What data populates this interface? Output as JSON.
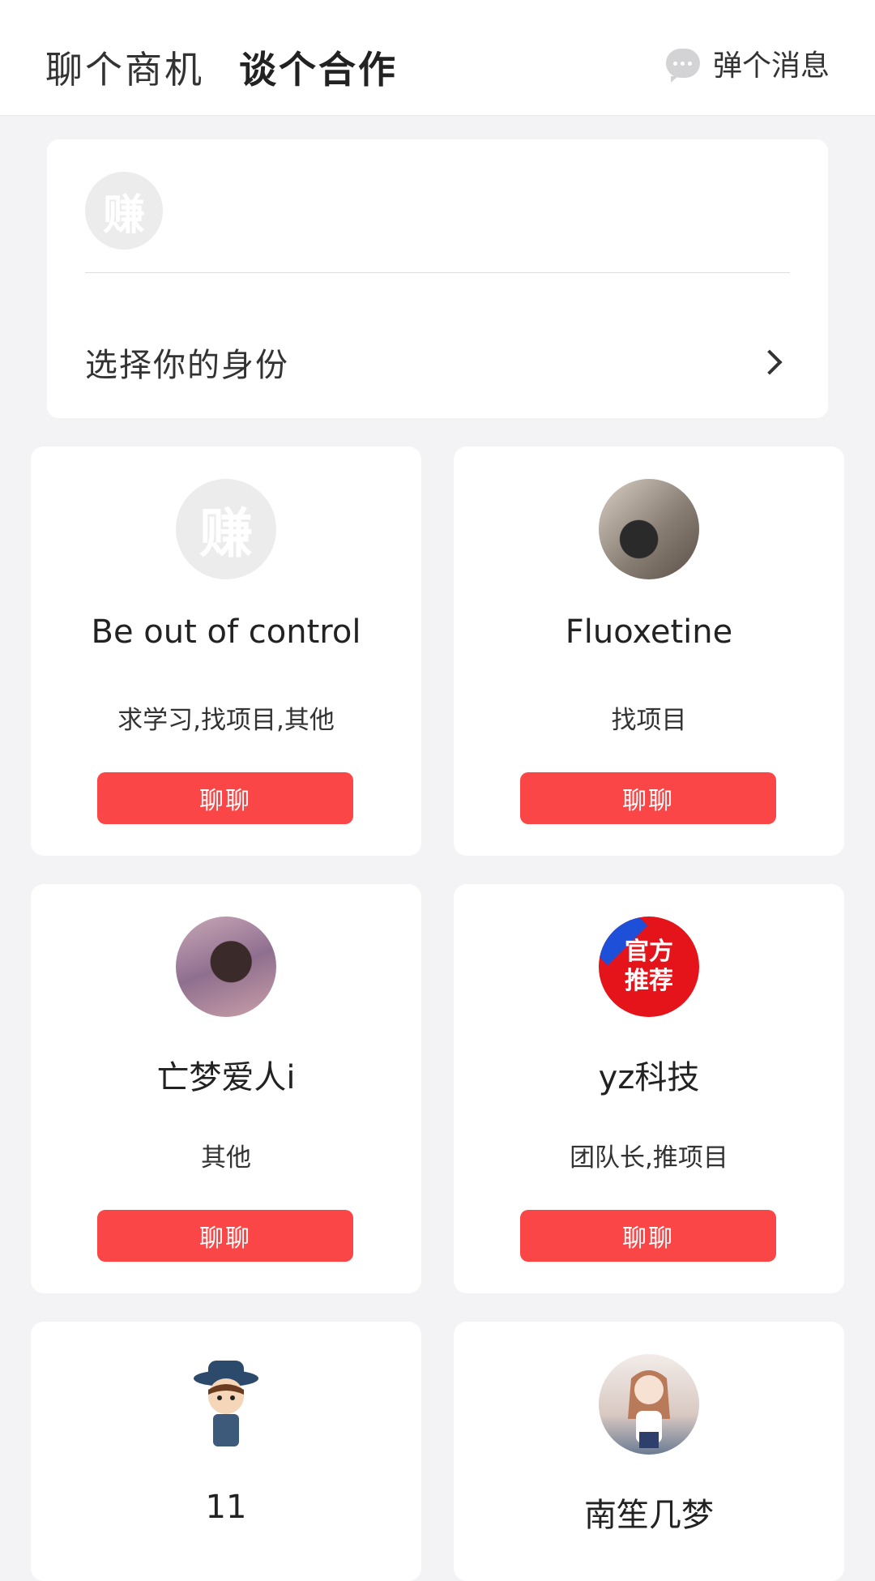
{
  "header": {
    "tabs": [
      {
        "label": "聊个商机"
      },
      {
        "label": "谈个合作"
      }
    ],
    "message_button": "弹个消息"
  },
  "identity": {
    "avatar_text": "赚",
    "select_label": "选择你的身份"
  },
  "cards": [
    {
      "name": "Be out of control",
      "tags": "求学习,找项目,其他",
      "button": "聊聊",
      "avatar": "logo",
      "avatar_text": "赚"
    },
    {
      "name": "Fluoxetine",
      "tags": "找项目",
      "button": "聊聊",
      "avatar": "photo"
    },
    {
      "name": "亡梦爱人i",
      "tags": "其他",
      "button": "聊聊",
      "avatar": "photo"
    },
    {
      "name": "yz科技",
      "tags": "团队长,推项目",
      "button": "聊聊",
      "avatar": "official",
      "avatar_lines": [
        "官方",
        "推荐"
      ]
    },
    {
      "name": "11",
      "tags": "",
      "button": "",
      "avatar": "cartoon"
    },
    {
      "name": "南笙几梦",
      "tags": "",
      "button": "",
      "avatar": "anime"
    }
  ],
  "colors": {
    "accent": "#fa4646",
    "background": "#f3f3f5",
    "official_badge": "#e4141a"
  }
}
